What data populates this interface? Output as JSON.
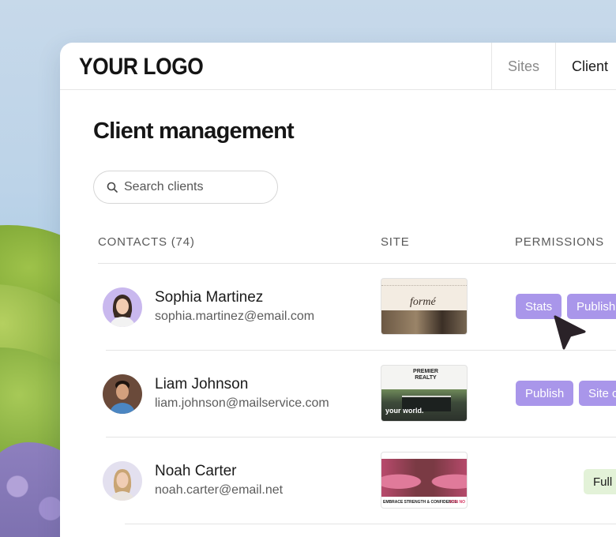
{
  "logo": "YOUR LOGO",
  "nav": {
    "tabs": [
      "Sites",
      "Client"
    ]
  },
  "page_title": "Client management",
  "search": {
    "placeholder": "Search clients"
  },
  "table": {
    "headers": {
      "contacts": "CONTACTS (74)",
      "site": "SITE",
      "permissions": "PERMISSIONS"
    },
    "rows": [
      {
        "name": "Sophia Martinez",
        "email": "sophia.martinez@email.com",
        "site_text": "formé",
        "permissions": [
          "Stats",
          "Publish"
        ]
      },
      {
        "name": "Liam Johnson",
        "email": "liam.johnson@mailservice.com",
        "site_text": "PREMIER REALTY",
        "site_text2": "your world.",
        "permissions": [
          "Publish",
          "Site c"
        ]
      },
      {
        "name": "Noah Carter",
        "email": "noah.carter@email.net",
        "site_text": "EMBRACE STRENGTH & CONFIDENCE",
        "site_text2": "JOIN NO",
        "permissions": [
          "Full e"
        ]
      }
    ]
  },
  "colors": {
    "permission_badge": "#a996ea",
    "full_access_badge": "#e3f2d8"
  },
  "icons": [
    "search-icon",
    "cursor-pointer-icon"
  ]
}
